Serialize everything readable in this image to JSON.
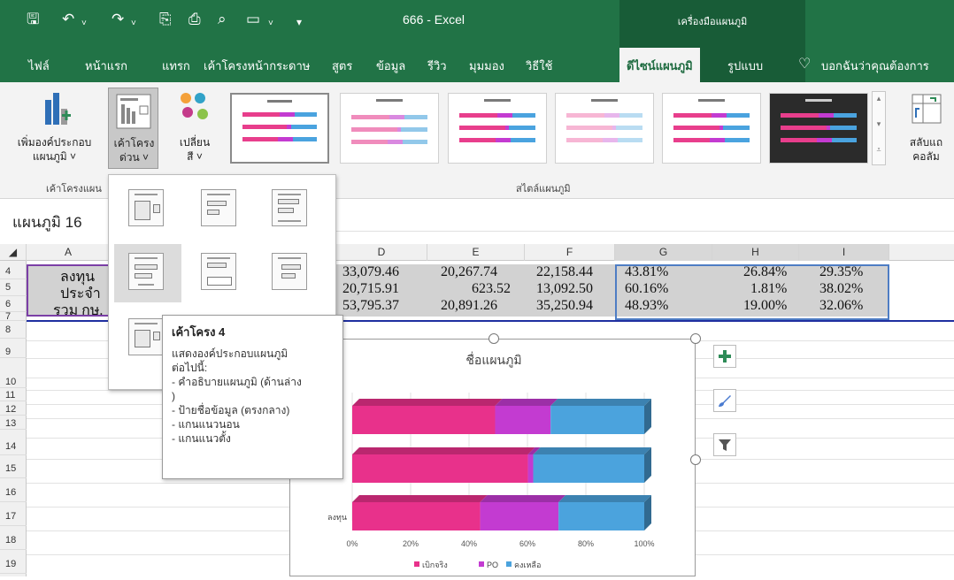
{
  "titlebar": {
    "title": "666  -  Excel",
    "context_tools": "เครื่องมือแผนภูมิ",
    "icons": [
      "save-icon",
      "undo-icon",
      "redo-icon",
      "print-preview-icon",
      "quick-print-icon",
      "preview-icon",
      "form-icon",
      "customize-icon"
    ]
  },
  "tabs": [
    {
      "label": "ไฟล์"
    },
    {
      "label": "หน้าแรก"
    },
    {
      "label": "แทรก"
    },
    {
      "label": "เค้าโครงหน้ากระดาษ"
    },
    {
      "label": "สูตร"
    },
    {
      "label": "ข้อมูล"
    },
    {
      "label": "รีวิว"
    },
    {
      "label": "มุมมอง"
    },
    {
      "label": "วิธีใช้"
    },
    {
      "label": "ดีไซน์แผนภูมิ"
    },
    {
      "label": "รูปแบบ"
    }
  ],
  "tell_me": "บอกฉันว่าคุณต้องการ",
  "ribbon": {
    "add_element": {
      "line1": "เพิ่มองค์ประกอบ",
      "line2": "แผนภูมิ ˅"
    },
    "quick_layout": {
      "line1": "เค้าโครง",
      "line2": "ด่วน ˅"
    },
    "change_color": {
      "line1": "เปลี่ยน",
      "line2": "สี ˅"
    },
    "switch": {
      "line1": "สลับแถ",
      "line2": "คอลัม"
    },
    "group_layouts": "เค้าโครงแผน",
    "group_styles": "สไตล์แผนภูมิ",
    "accent_pink": "#e83e8c",
    "accent_blue": "#4aa3df"
  },
  "namebox": "แผนภูมิ 16",
  "columns": [
    "A",
    "D",
    "E",
    "F",
    "G",
    "H",
    "I"
  ],
  "rows": [
    "4",
    "5",
    "6",
    "7",
    "8",
    "9",
    "10",
    "11",
    "12",
    "13",
    "14",
    "15",
    "16",
    "17",
    "18",
    "19"
  ],
  "cells": {
    "r4": {
      "a": "ลงทุน",
      "d": "33,079.46",
      "e": "20,267.74",
      "f": "22,158.44",
      "g": "43.81%",
      "h": "26.84%",
      "i": "29.35%"
    },
    "r5": {
      "a": "ประจำ",
      "d": "20,715.91",
      "e": "623.52",
      "f": "13,092.50",
      "g": "60.16%",
      "h": "1.81%",
      "i": "38.02%"
    },
    "r6": {
      "a": "รวม กษ.",
      "d": "53,795.37",
      "e": "20,891.26",
      "f": "35,250.94",
      "g": "48.93%",
      "h": "19.00%",
      "i": "32.06%"
    }
  },
  "tooltip": {
    "title": "เค้าโครง 4",
    "line1": "แสดงองค์ประกอบแผนภูมิ",
    "line2": "ต่อไปนี้:",
    "line3": "- คำอธิบายแผนภูมิ (ด้านล่าง",
    "line4": ")",
    "line5": "- ป้ายชื่อข้อมูล (ตรงกลาง)",
    "line6": "- แกนแนวนอน",
    "line7": "- แกนแนวตั้ง"
  },
  "chart_data": {
    "type": "bar",
    "orientation": "horizontal",
    "stacked": "percent",
    "title": "ชื่อแผนภูมิ",
    "categories": [
      "ลงทุน",
      "",
      ""
    ],
    "series": [
      {
        "name": "เบิกจริง",
        "color": "#e8318b",
        "values": [
          43.81,
          60.16,
          48.93
        ]
      },
      {
        "name": "PO",
        "color": "#c33bd1",
        "values": [
          26.84,
          1.81,
          19.0
        ]
      },
      {
        "name": "คงเหลือ",
        "color": "#4ba3dd",
        "values": [
          29.35,
          38.02,
          32.06
        ]
      }
    ],
    "xticks": [
      "0%",
      "20%",
      "40%",
      "60%",
      "80%",
      "100%"
    ],
    "xlim": [
      0,
      100
    ],
    "legend": "bottom"
  }
}
